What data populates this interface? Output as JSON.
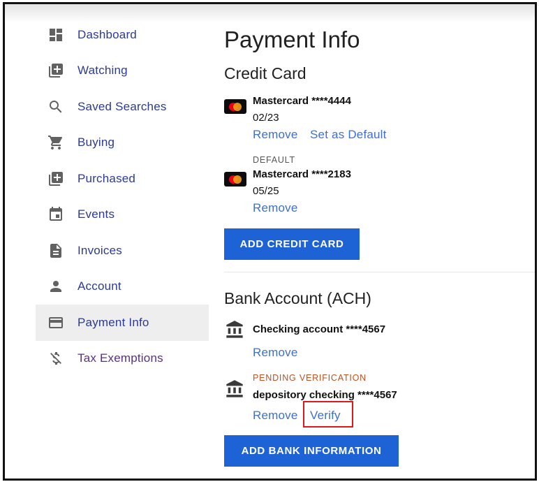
{
  "sidebar": {
    "items": [
      {
        "label": "Dashboard",
        "icon": "dashboard-icon"
      },
      {
        "label": "Watching",
        "icon": "library-add-icon"
      },
      {
        "label": "Saved Searches",
        "icon": "search-icon"
      },
      {
        "label": "Buying",
        "icon": "cart-icon"
      },
      {
        "label": "Purchased",
        "icon": "library-add-icon"
      },
      {
        "label": "Events",
        "icon": "calendar-icon"
      },
      {
        "label": "Invoices",
        "icon": "document-icon"
      },
      {
        "label": "Account",
        "icon": "person-icon"
      },
      {
        "label": "Payment Info",
        "icon": "credit-card-icon",
        "active": true
      },
      {
        "label": "Tax Exemptions",
        "icon": "money-off-icon"
      }
    ]
  },
  "main": {
    "title": "Payment Info",
    "credit_card": {
      "heading": "Credit Card",
      "cards": [
        {
          "name": "Mastercard ****4444",
          "expiry": "02/23",
          "remove_label": "Remove",
          "default_label": "Set as Default"
        },
        {
          "tag": "DEFAULT",
          "name": "Mastercard ****2183",
          "expiry": "05/25",
          "remove_label": "Remove"
        }
      ],
      "add_button": "ADD CREDIT CARD"
    },
    "bank": {
      "heading": "Bank Account (ACH)",
      "accounts": [
        {
          "name": "Checking account ****4567",
          "remove_label": "Remove"
        },
        {
          "tag": "PENDING VERIFICATION",
          "name": "depository checking ****4567",
          "remove_label": "Remove",
          "verify_label": "Verify"
        }
      ],
      "add_button": "ADD BANK INFORMATION"
    }
  },
  "colors": {
    "link": "#3e6fd0",
    "button": "#1e63d6",
    "nav_label": "#2c3a97",
    "pending": "#c0501f",
    "highlight": "#e11818"
  }
}
